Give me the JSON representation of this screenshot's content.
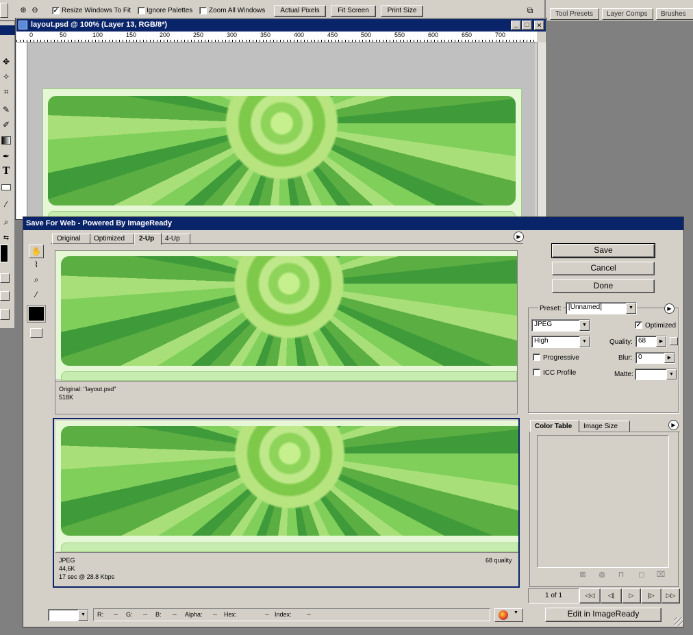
{
  "options_bar": {
    "resize_windows": "Resize Windows To Fit",
    "ignore_palettes": "Ignore Palettes",
    "zoom_all": "Zoom All Windows",
    "actual_pixels": "Actual Pixels",
    "fit_screen": "Fit Screen",
    "print_size": "Print Size",
    "resize_checked": "✓",
    "ignore_checked": "",
    "zoom_checked": ""
  },
  "palette_well": {
    "tabs": [
      "Tool Presets",
      "Layer Comps",
      "Brushes"
    ]
  },
  "document": {
    "title": "layout.psd @ 100% (Layer 13, RGB/8*)",
    "ruler_labels": [
      "0",
      "50",
      "100",
      "150",
      "200",
      "250",
      "300",
      "350",
      "400",
      "450",
      "500",
      "550",
      "600",
      "650",
      "700"
    ],
    "minimize": "_",
    "maximize": "□",
    "close": "✕"
  },
  "toolbox": {
    "text_tool": "T"
  },
  "sfw": {
    "title": "Save For Web - Powered By ImageReady",
    "tabs": [
      "Original",
      "Optimized",
      "2-Up",
      "4-Up"
    ],
    "active_tab": "2-Up",
    "original_info": {
      "name": "Original: \"layout.psd\"",
      "size": "518K"
    },
    "optimized_info": {
      "format": "JPEG",
      "size": "44,6K",
      "time": "17 sec @ 28.8 Kbps",
      "quality_note": "68 quality"
    },
    "buttons": {
      "save": "Save",
      "cancel": "Cancel",
      "done": "Done",
      "edit_in_imageready": "Edit in ImageReady"
    },
    "settings": {
      "preset_label": "Preset:",
      "preset_value": "[Unnamed]",
      "format_value": "JPEG",
      "quality_preset": "High",
      "optimized_label": "Optimized",
      "optimized_checked": "✓",
      "quality_label": "Quality:",
      "quality_value": "68",
      "progressive_label": "Progressive",
      "blur_label": "Blur:",
      "blur_value": "0",
      "icc_label": "ICC Profile",
      "matte_label": "Matte:",
      "matte_value": ""
    },
    "panel_tabs": [
      "Color Table",
      "Image Size"
    ],
    "pager": {
      "page": "1 of 1"
    },
    "status": {
      "r": "R:",
      "r_val": "--",
      "g": "G:",
      "g_val": "--",
      "b": "B:",
      "b_val": "--",
      "alpha": "Alpha:",
      "alpha_val": "--",
      "hex": "Hex:",
      "hex_val": "--",
      "index": "Index:",
      "index_val": "--"
    }
  },
  "colors": {
    "title_bar": "#0a246a",
    "dialog_bg": "#d4d0c8",
    "canvas_gray": "#c0c0c0",
    "leaf_green": "#6abf48"
  }
}
